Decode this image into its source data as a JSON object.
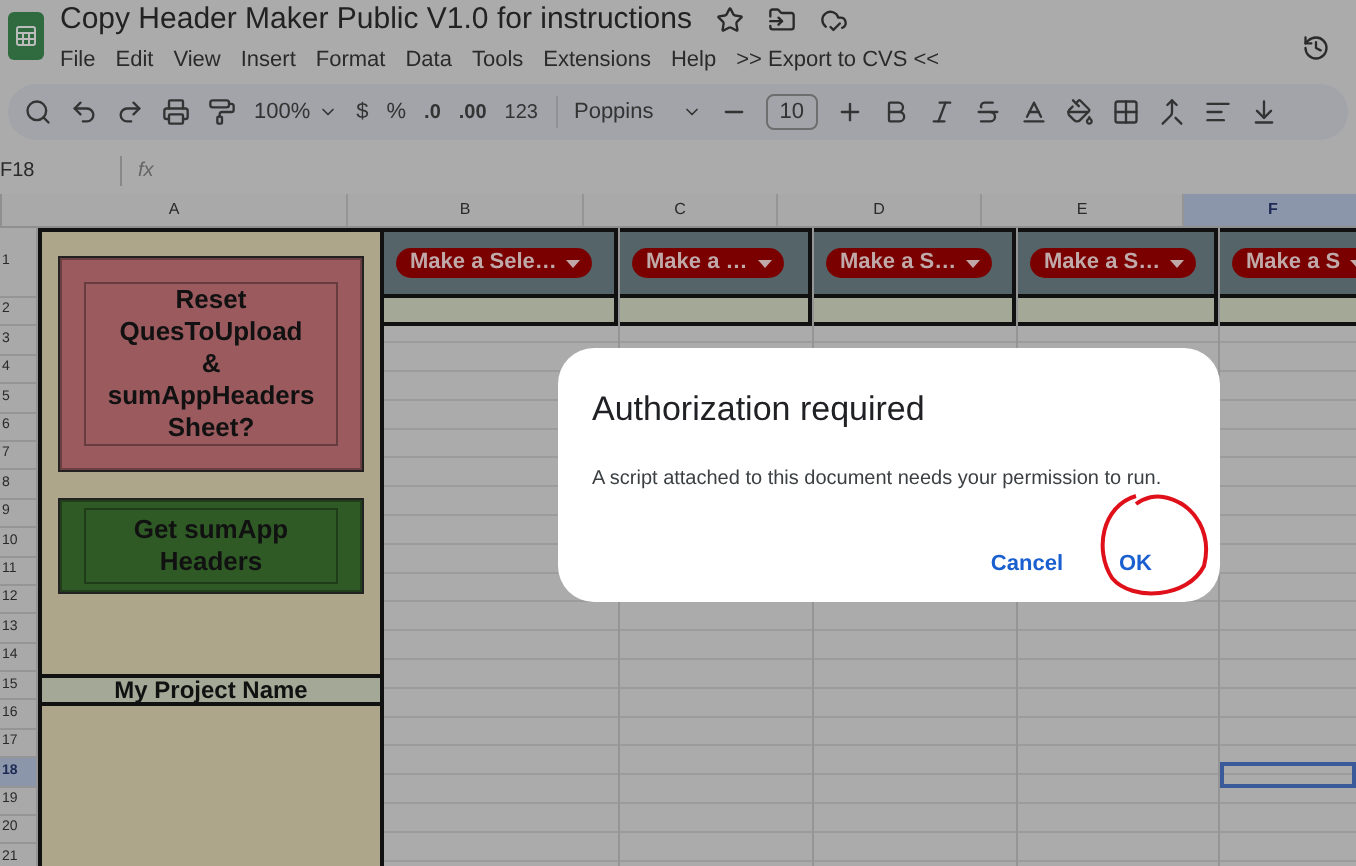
{
  "app": {
    "title": "Copy Header Maker Public V1.0 for instructions",
    "menu": [
      "File",
      "Edit",
      "View",
      "Insert",
      "Format",
      "Data",
      "Tools",
      "Extensions",
      "Help",
      ">> Export to CVS <<"
    ]
  },
  "toolbar": {
    "zoom": "100%",
    "currency": "$",
    "percent": "%",
    "decrease_decimal": ".0",
    "increase_decimal": ".00",
    "number_format": "123",
    "font": "Poppins",
    "font_size": "10"
  },
  "formula_bar": {
    "cell": "F18",
    "fx": "fx"
  },
  "columns": [
    {
      "label": "A",
      "selected": false
    },
    {
      "label": "B",
      "selected": false
    },
    {
      "label": "C",
      "selected": false
    },
    {
      "label": "D",
      "selected": false
    },
    {
      "label": "E",
      "selected": false
    },
    {
      "label": "F",
      "selected": true
    }
  ],
  "rows": [
    {
      "label": "1",
      "selected": false
    },
    {
      "label": "2",
      "selected": false
    },
    {
      "label": "3",
      "selected": false
    },
    {
      "label": "4",
      "selected": false
    },
    {
      "label": "5",
      "selected": false
    },
    {
      "label": "6",
      "selected": false
    },
    {
      "label": "7",
      "selected": false
    },
    {
      "label": "8",
      "selected": false
    },
    {
      "label": "9",
      "selected": false
    },
    {
      "label": "10",
      "selected": false
    },
    {
      "label": "11",
      "selected": false
    },
    {
      "label": "12",
      "selected": false
    },
    {
      "label": "13",
      "selected": false
    },
    {
      "label": "14",
      "selected": false
    },
    {
      "label": "15",
      "selected": false
    },
    {
      "label": "16",
      "selected": false
    },
    {
      "label": "17",
      "selected": false
    },
    {
      "label": "18",
      "selected": true
    },
    {
      "label": "19",
      "selected": false
    },
    {
      "label": "20",
      "selected": false
    },
    {
      "label": "21",
      "selected": false
    }
  ],
  "column_a": {
    "buttons": [
      {
        "label": "Reset QuesToUpload & sumAppHeaders Sheet?",
        "color": "#9a5a5e"
      },
      {
        "label": "Get sumApp Headers",
        "color": "#2f5a26"
      }
    ],
    "project_name": "My Project Name"
  },
  "dropdowns": [
    "Make a Sele…",
    "Make a …",
    "Make a S…",
    "Make a S…",
    "Make a S"
  ],
  "dialog": {
    "title": "Authorization required",
    "message": "A script attached to this document needs your permission to run.",
    "buttons": [
      "Cancel",
      "OK"
    ]
  }
}
